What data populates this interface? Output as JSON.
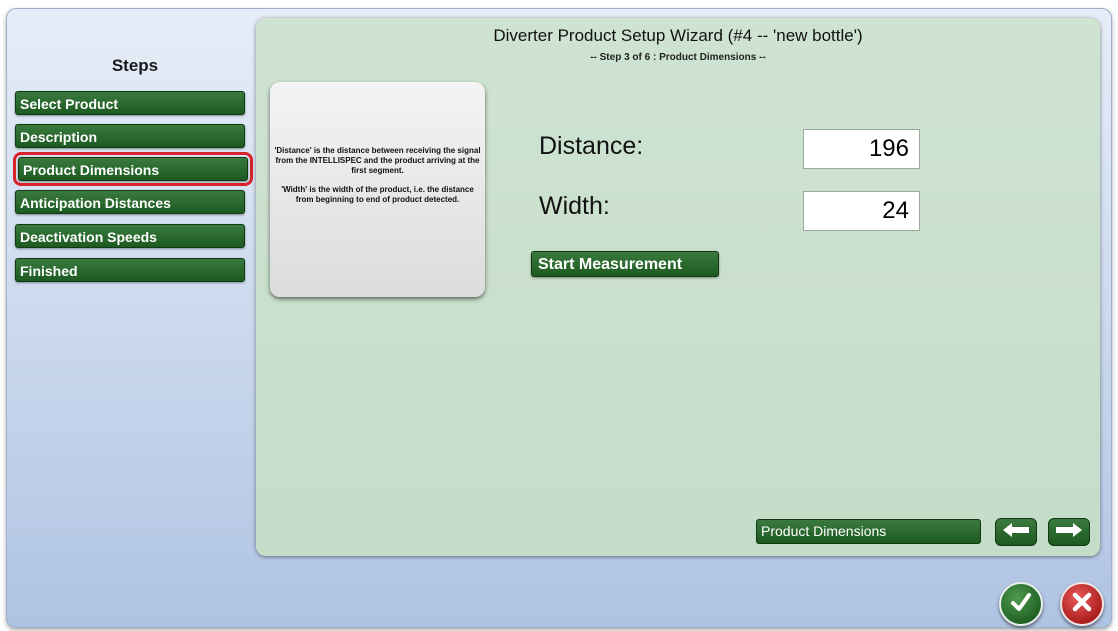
{
  "sidebar": {
    "title": "Steps",
    "items": [
      {
        "label": "Select Product"
      },
      {
        "label": "Description"
      },
      {
        "label": "Product Dimensions"
      },
      {
        "label": "Anticipation Distances"
      },
      {
        "label": "Deactivation Speeds"
      },
      {
        "label": "Finished"
      }
    ]
  },
  "wizard": {
    "title": "Diverter Product Setup Wizard (#4 -- 'new bottle')",
    "subtitle": "-- Step 3 of 6 : Product Dimensions --"
  },
  "info": {
    "paragraph1": "'Distance' is the distance between receiving the signal from the INTELLISPEC and the product arriving at the first segment.",
    "paragraph2": "'Width' is the width of the product, i.e. the distance from beginning to end of product detected."
  },
  "fields": {
    "distance_label": "Distance:",
    "distance_value": "196",
    "width_label": "Width:",
    "width_value": "24"
  },
  "buttons": {
    "start_measurement": "Start Measurement",
    "current_step": "Product Dimensions",
    "back_icon": "arrow-left-icon",
    "next_icon": "arrow-right-icon",
    "ok_icon": "checkmark-icon",
    "cancel_icon": "close-icon"
  },
  "colors": {
    "accent_green": "#1c5a21",
    "active_highlight": "#d8222a",
    "cancel_red": "#a81b1b"
  }
}
